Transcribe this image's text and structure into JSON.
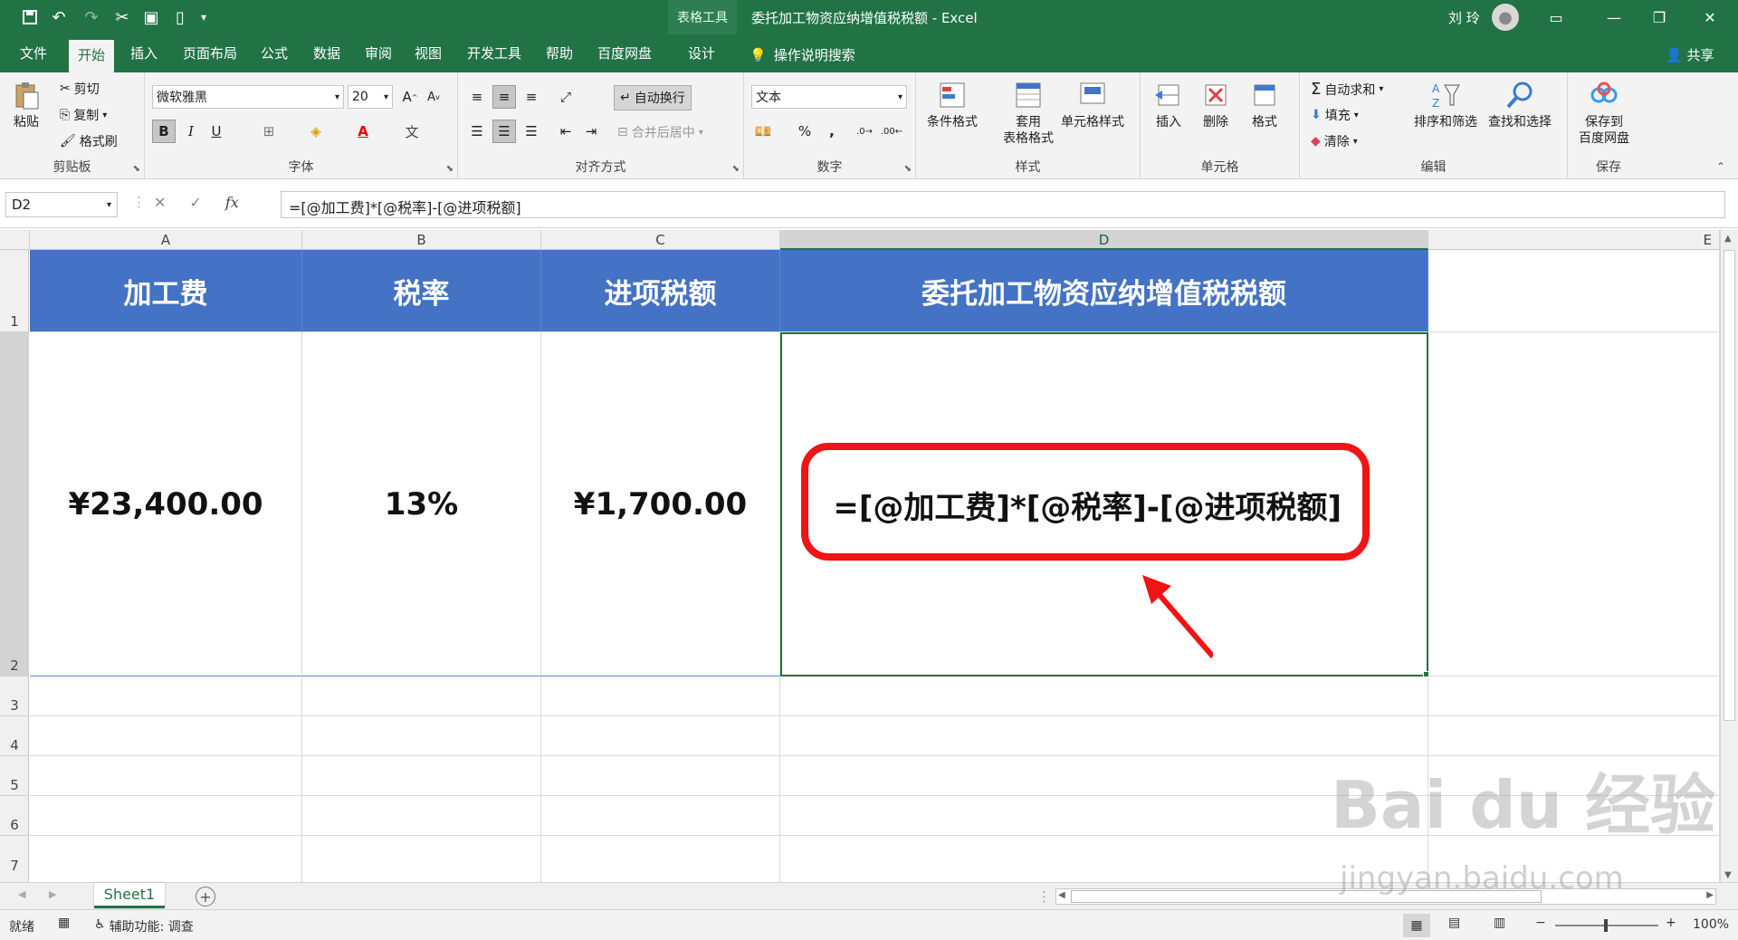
{
  "titlebar": {
    "context_group": "表格工具",
    "title": "委托加工物资应纳增值税税额 - Excel",
    "user": "刘 玲"
  },
  "tabs": [
    "文件",
    "开始",
    "插入",
    "页面布局",
    "公式",
    "数据",
    "审阅",
    "视图",
    "开发工具",
    "帮助",
    "百度网盘",
    "设计"
  ],
  "active_tab": "开始",
  "tell_me": "操作说明搜索",
  "share": "共享",
  "ribbon": {
    "clipboard": {
      "label": "剪贴板",
      "paste": "粘贴",
      "cut": "剪切",
      "copy": "复制",
      "format_painter": "格式刷"
    },
    "font": {
      "label": "字体",
      "name": "微软雅黑",
      "size": "20",
      "bold": "B",
      "italic": "I",
      "underline": "U"
    },
    "alignment": {
      "label": "对齐方式",
      "wrap": "自动换行",
      "merge": "合并后居中"
    },
    "number": {
      "label": "数字",
      "format": "文本",
      "percent": "%",
      "comma": ","
    },
    "styles": {
      "label": "样式",
      "conditional": "条件格式",
      "table_line1": "套用",
      "table_line2": "表格格式",
      "cell_styles": "单元格样式"
    },
    "cells": {
      "label": "单元格",
      "insert": "插入",
      "delete": "删除",
      "format": "格式"
    },
    "editing": {
      "label": "编辑",
      "autosum": "自动求和",
      "fill": "填充",
      "clear": "清除",
      "sort": "排序和筛选",
      "find": "查找和选择"
    },
    "save": {
      "label": "保存",
      "line1": "保存到",
      "line2": "百度网盘"
    }
  },
  "formula_bar": {
    "name_box": "D2",
    "formula": "=[@加工费]*[@税率]-[@进项税额]"
  },
  "columns": [
    "A",
    "B",
    "C",
    "D",
    "E"
  ],
  "rows": [
    "1",
    "2",
    "3",
    "4",
    "5",
    "6",
    "7"
  ],
  "table": {
    "headers": [
      "加工费",
      "税率",
      "进项税额",
      "委托加工物资应纳增值税税额"
    ],
    "values": [
      "¥23,400.00",
      "13%",
      "¥1,700.00",
      "=[@加工费]*[@税率]-[@进项税额]"
    ]
  },
  "sheets": [
    "Sheet1"
  ],
  "status": {
    "ready": "就绪",
    "accessibility": "辅助功能: 调查",
    "zoom": "100%"
  },
  "watermark": {
    "main": "Bai du 经验",
    "sub": "jingyan.baidu.com"
  },
  "colors": {
    "excel_green": "#217346",
    "header_blue": "#4472c4",
    "annotation_red": "#f01414"
  }
}
